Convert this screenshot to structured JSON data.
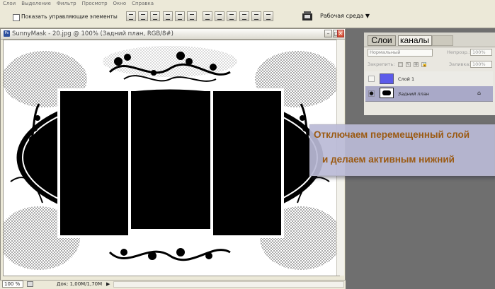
{
  "menu": [
    "Слои",
    "Выделение",
    "Фильтр",
    "Просмотр",
    "Окно",
    "Справка"
  ],
  "options": {
    "show_controls_label": "Показать управляющие элементы",
    "workspace_label": "Рабочая среда ▼"
  },
  "document": {
    "title": "SunnyMask - 20.jpg @ 100% (Задний план, RGB/8#)",
    "ps_badge": "Ps",
    "zoom": "100 %",
    "doc_info": "Док: 1,00M/1,70M",
    "status_arrow": "▶"
  },
  "window_buttons": {
    "minimize": "–",
    "maximize": "□",
    "close": "✕"
  },
  "layers_panel": {
    "tabs": [
      "Слои",
      "каналы"
    ],
    "blend_mode": "Нормальный",
    "opacity_label": "Непрозр.:",
    "opacity_value": "100%",
    "lock_label": "Закрепить:",
    "lock_icons": [
      "□",
      "✎",
      "✚",
      "🔒"
    ],
    "fill_label": "Заливка:",
    "fill_value": "100%",
    "layers": [
      {
        "name": "Слой 1",
        "visible": false,
        "thumb_color": "#5c5bea"
      },
      {
        "name": "Задний план",
        "visible": true,
        "locked": true,
        "selected": true
      }
    ],
    "lock_glyph": "⌂",
    "eye_glyph": "●"
  },
  "callout": {
    "line1": "Отключаем перемещенный слой",
    "line2": "и делаем активным нижний"
  },
  "colors": {
    "callout_text": "#9b5a12",
    "callout_bg": "#babad6",
    "selected_layer": "#a9a9c8",
    "layer1_thumb": "#5c5bea"
  }
}
